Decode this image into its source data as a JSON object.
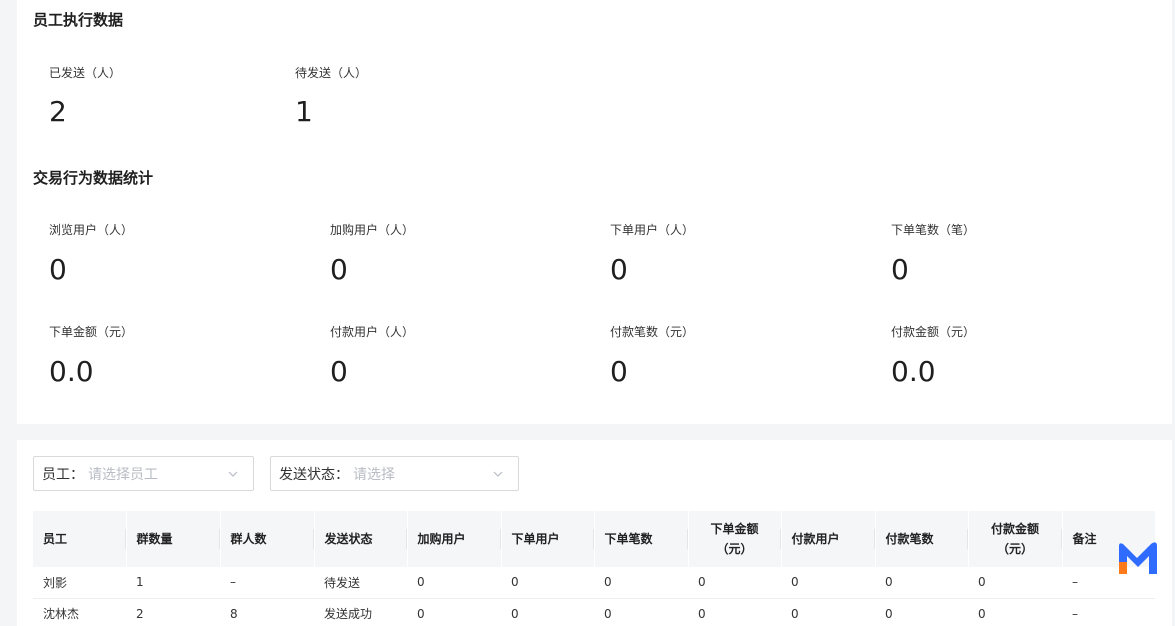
{
  "exec": {
    "title": "员工执行数据",
    "stats": [
      {
        "label": "已发送（人）",
        "value": "2"
      },
      {
        "label": "待发送（人）",
        "value": "1"
      }
    ]
  },
  "trade": {
    "title": "交易行为数据统计",
    "stats": [
      {
        "label": "浏览用户（人）",
        "value": "0"
      },
      {
        "label": "加购用户（人）",
        "value": "0"
      },
      {
        "label": "下单用户（人）",
        "value": "0"
      },
      {
        "label": "下单笔数（笔）",
        "value": "0"
      },
      {
        "label": "下单金额（元）",
        "value": "0.0"
      },
      {
        "label": "付款用户（人）",
        "value": "0"
      },
      {
        "label": "付款笔数（元）",
        "value": "0"
      },
      {
        "label": "付款金额（元）",
        "value": "0.0"
      }
    ]
  },
  "filters": {
    "employee": {
      "label": "员工：",
      "placeholder": "请选择员工"
    },
    "status": {
      "label": "发送状态：",
      "placeholder": "请选择"
    }
  },
  "table": {
    "headers": [
      "员工",
      "群数量",
      "群人数",
      "发送状态",
      "加购用户",
      "下单用户",
      "下单笔数",
      "下单金额（元）",
      "付款用户",
      "付款笔数",
      "付款金额（元）",
      "备注"
    ],
    "rows": [
      [
        "刘影",
        "1",
        "–",
        "待发送",
        "0",
        "0",
        "0",
        "0",
        "0",
        "0",
        "0",
        "–"
      ],
      [
        "沈林杰",
        "2",
        "8",
        "发送成功",
        "0",
        "0",
        "0",
        "0",
        "0",
        "0",
        "0",
        "–"
      ]
    ]
  },
  "colors": {
    "logo_blue": "#2f6bff",
    "logo_orange": "#ff7a1a"
  }
}
